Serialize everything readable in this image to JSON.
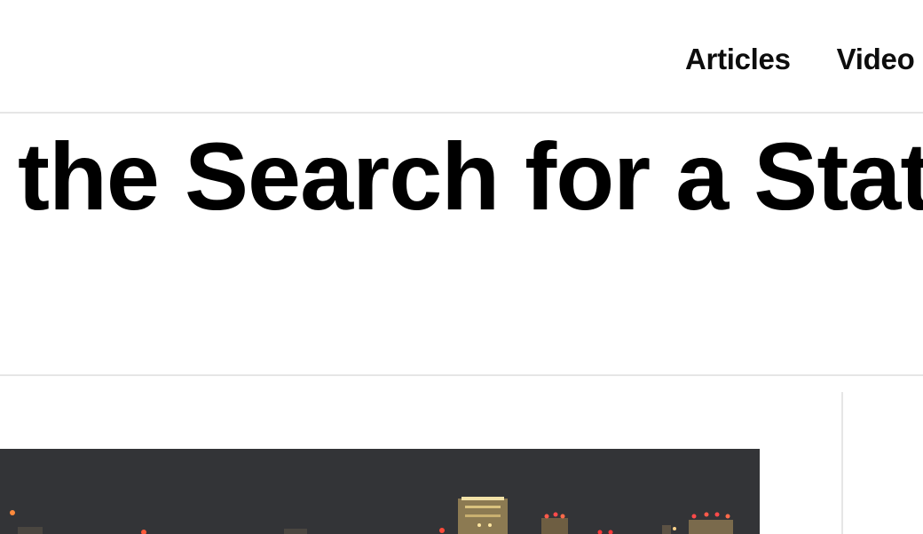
{
  "nav": {
    "items": [
      {
        "label": "Articles"
      },
      {
        "label": "Video"
      }
    ]
  },
  "article": {
    "headline": "the Search for a Statu"
  },
  "hero": {
    "icon": "city-skyline-night-photo"
  }
}
